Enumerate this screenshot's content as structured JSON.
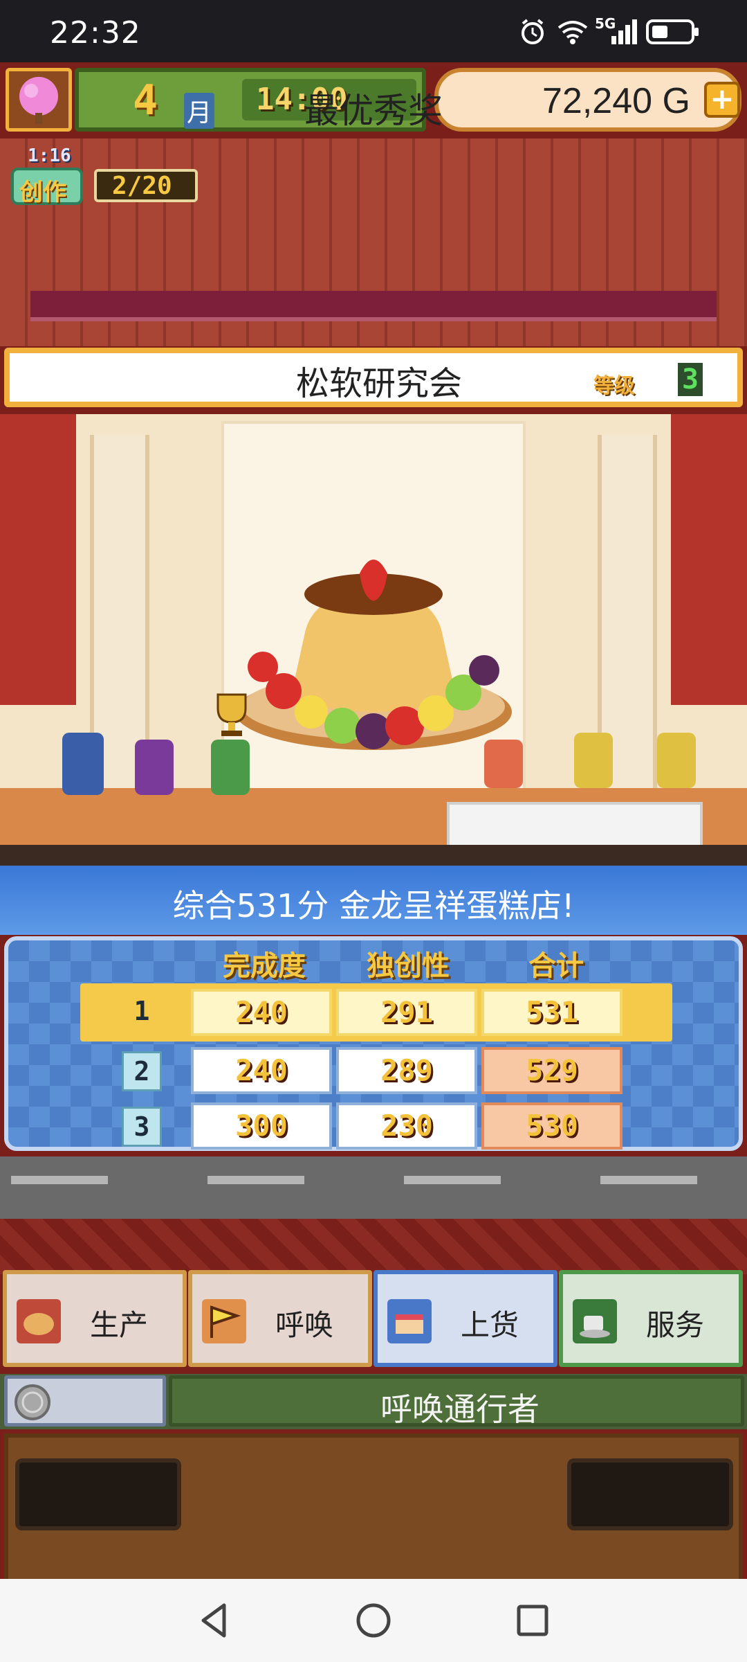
{
  "status_bar": {
    "time": "22:32",
    "icons": [
      "alarm-icon",
      "wifi-icon",
      "signal-5g-icon",
      "battery-icon"
    ],
    "network": "5G"
  },
  "hud": {
    "month": "4",
    "month_label": "月",
    "time": "14:00",
    "money": "72,240 G",
    "add_money_icon": "plus-icon"
  },
  "create": {
    "timer": "1:16",
    "label": "创作",
    "count": "2/20"
  },
  "contest": {
    "name": "松软研究会",
    "level_label": "等级",
    "level": "3",
    "award": "最优秀奖",
    "summary": "综合531分 金龙呈祥蛋糕店!"
  },
  "scores": {
    "headers": [
      "完成度",
      "独创性",
      "合计"
    ],
    "rows": [
      {
        "rank": "1",
        "completion": "240",
        "originality": "291",
        "total": "531"
      },
      {
        "rank": "2",
        "completion": "240",
        "originality": "289",
        "total": "529"
      },
      {
        "rank": "3",
        "completion": "300",
        "originality": "230",
        "total": "530"
      }
    ]
  },
  "actions": [
    {
      "label": "生产",
      "icon": "bread-icon",
      "color": "#cf9a4a"
    },
    {
      "label": "呼唤",
      "icon": "flag-icon",
      "color": "#cf9a4a"
    },
    {
      "label": "上货",
      "icon": "cake-icon",
      "color": "#4a78c8"
    },
    {
      "label": "服务",
      "icon": "coffee-icon",
      "color": "#4f9a4a"
    }
  ],
  "call_bar": {
    "label": "呼唤通行者"
  },
  "nav": [
    "back-icon",
    "home-icon",
    "recents-icon"
  ],
  "colors": {
    "gold": "#f2b13c",
    "panel_blue": "#5b8fd6",
    "hud_green": "#6e9e3c"
  }
}
